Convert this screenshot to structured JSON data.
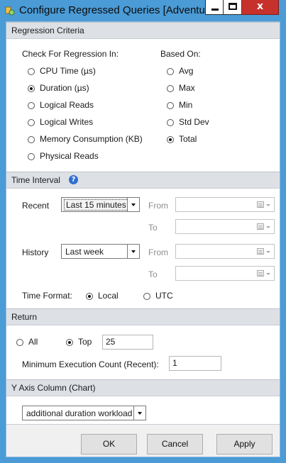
{
  "window": {
    "title": "Configure Regressed Queries [Adventure...",
    "minimize_icon": "minimize-icon",
    "maximize_icon": "maximize-icon",
    "close_glyph": "x"
  },
  "regression": {
    "header": "Regression Criteria",
    "check_label": "Check For Regression In:",
    "based_label": "Based On:",
    "metrics": [
      {
        "label": "CPU Time (µs)",
        "checked": false
      },
      {
        "label": "Duration (µs)",
        "checked": true
      },
      {
        "label": "Logical Reads",
        "checked": false
      },
      {
        "label": "Logical Writes",
        "checked": false
      },
      {
        "label": "Memory Consumption (KB)",
        "checked": false
      },
      {
        "label": "Physical Reads",
        "checked": false
      }
    ],
    "aggregations": [
      {
        "label": "Avg",
        "checked": false
      },
      {
        "label": "Max",
        "checked": false
      },
      {
        "label": "Min",
        "checked": false
      },
      {
        "label": "Std Dev",
        "checked": false
      },
      {
        "label": "Total",
        "checked": true
      }
    ]
  },
  "time_interval": {
    "header": "Time Interval",
    "recent_label": "Recent",
    "recent_value": "Last 15 minutes",
    "history_label": "History",
    "history_value": "Last week",
    "from_label": "From",
    "to_label": "To",
    "format_label": "Time Format:",
    "formats": [
      {
        "label": "Local",
        "checked": true
      },
      {
        "label": "UTC",
        "checked": false
      }
    ]
  },
  "return": {
    "header": "Return",
    "all_label": "All",
    "top_label": "Top",
    "top_value": "25",
    "min_exec_label": "Minimum Execution Count (Recent):",
    "min_exec_value": "1"
  },
  "y_axis": {
    "header": "Y Axis Column (Chart)",
    "value": "additional duration workload"
  },
  "buttons": {
    "ok": "OK",
    "cancel": "Cancel",
    "apply": "Apply"
  },
  "colors": {
    "title_bar": "#4a9bd6",
    "section_header": "#dde1e6",
    "close_button": "#c7312b"
  }
}
